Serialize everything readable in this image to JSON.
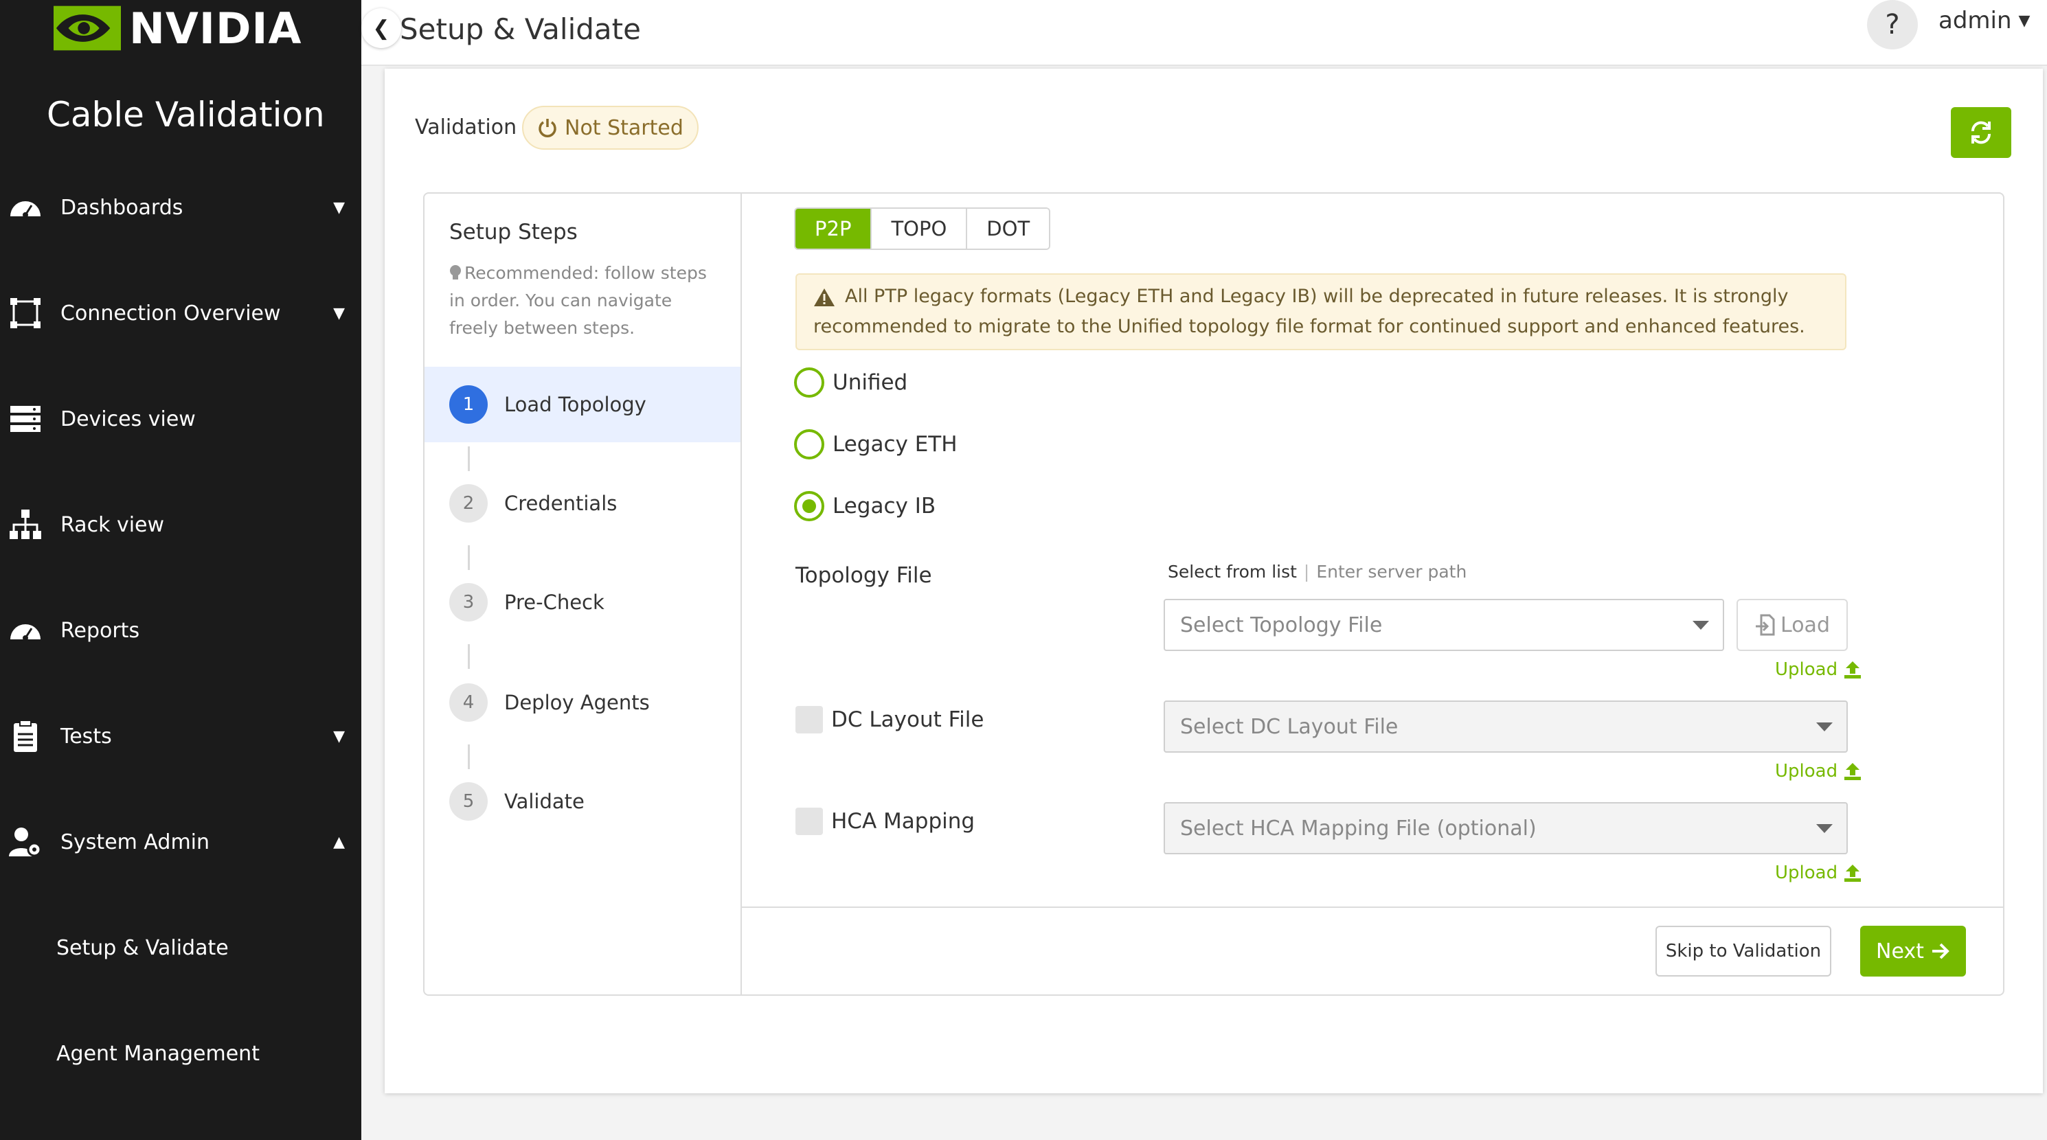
{
  "brand": {
    "logo_text": "NVIDIA",
    "app_title": "Cable Validation",
    "accent_color": "#76b900"
  },
  "sidebar": {
    "items": [
      {
        "label": "Dashboards",
        "icon": "gauge-icon",
        "chevron": "down"
      },
      {
        "label": "Connection Overview",
        "icon": "topology-frame-icon",
        "chevron": "down"
      },
      {
        "label": "Devices view",
        "icon": "server-rack-icon",
        "chevron": ""
      },
      {
        "label": "Rack view",
        "icon": "hierarchy-icon",
        "chevron": ""
      },
      {
        "label": "Reports",
        "icon": "gauge-icon",
        "chevron": ""
      },
      {
        "label": "Tests",
        "icon": "clipboard-icon",
        "chevron": "down"
      },
      {
        "label": "System Admin",
        "icon": "user-gear-icon",
        "chevron": "up"
      }
    ],
    "subitems": [
      {
        "label": "Setup & Validate"
      },
      {
        "label": "Agent Management"
      }
    ]
  },
  "header": {
    "title": "Setup & Validate",
    "help_label": "?",
    "user": "admin"
  },
  "validation": {
    "label": "Validation",
    "status": "Not Started"
  },
  "setup_steps": {
    "title": "Setup Steps",
    "hint": "Recommended: follow steps in order. You can navigate freely between steps.",
    "steps": [
      {
        "number": "1",
        "label": "Load Topology",
        "active": true
      },
      {
        "number": "2",
        "label": "Credentials",
        "active": false
      },
      {
        "number": "3",
        "label": "Pre-Check",
        "active": false
      },
      {
        "number": "4",
        "label": "Deploy Agents",
        "active": false
      },
      {
        "number": "5",
        "label": "Validate",
        "active": false
      }
    ]
  },
  "format_tabs": [
    {
      "label": "P2P",
      "active": true
    },
    {
      "label": "TOPO",
      "active": false
    },
    {
      "label": "DOT",
      "active": false
    }
  ],
  "warning": {
    "text": "All PTP legacy formats (Legacy ETH and Legacy IB) will be deprecated in future releases. It is strongly recommended to migrate to the Unified topology file format for continued support and enhanced features."
  },
  "format_options": [
    {
      "label": "Unified",
      "checked": false
    },
    {
      "label": "Legacy ETH",
      "checked": false
    },
    {
      "label": "Legacy IB",
      "checked": true
    }
  ],
  "topology": {
    "label": "Topology File",
    "source_active": "Select from list",
    "source_inactive": "Enter server path",
    "placeholder": "Select Topology File",
    "load_label": "Load",
    "upload_label": "Upload"
  },
  "dc_layout": {
    "label": "DC Layout File",
    "placeholder": "Select DC Layout File",
    "upload_label": "Upload"
  },
  "hca_mapping": {
    "label": "HCA Mapping",
    "placeholder": "Select HCA Mapping File (optional)",
    "upload_label": "Upload"
  },
  "footer": {
    "skip_label": "Skip to Validation",
    "next_label": "Next"
  }
}
